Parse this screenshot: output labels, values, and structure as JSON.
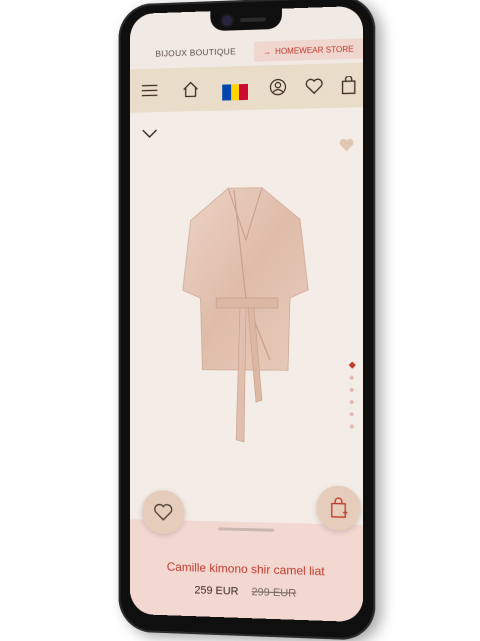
{
  "header": {
    "brand": "BIJOUX BOUTIQUE",
    "homewear_arrow": "→",
    "homewear_label": "HOMEWEAR STORE"
  },
  "nav": {
    "menu_icon": "menu-icon",
    "home_icon": "home-icon",
    "flag": {
      "name": "moldova-flag",
      "colors": [
        "#0046ae",
        "#ffd200",
        "#cc092f"
      ]
    },
    "account_icon": "user-icon",
    "wishlist_icon": "heart-icon",
    "cart_icon": "bag-icon"
  },
  "product": {
    "name": "Camille kimono shir camel liat",
    "price": "259 EUR",
    "old_price": "299 EUR",
    "gallery_dots": 6,
    "active_dot": 0
  },
  "colors": {
    "accent": "#c0392b",
    "nav_bg": "#e9ddc9",
    "sheet_bg": "#f3d8d2",
    "product_bg": "#f3ece7"
  }
}
